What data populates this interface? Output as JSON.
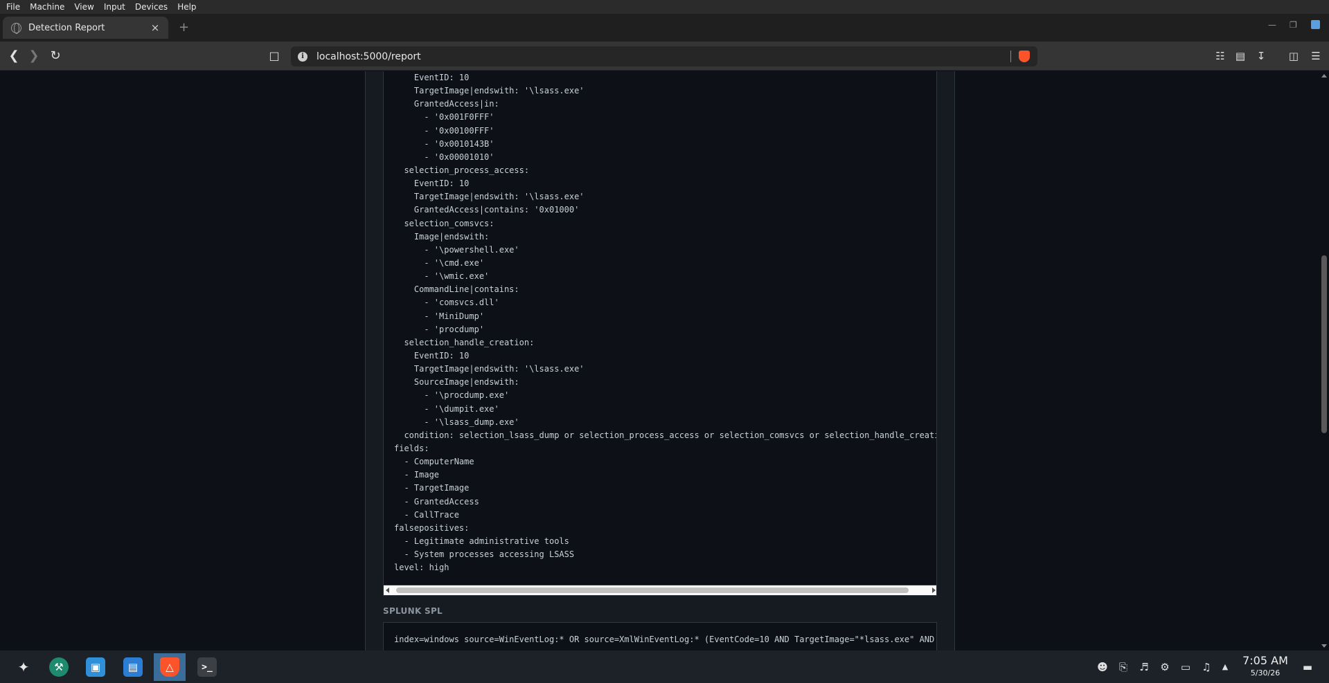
{
  "vm_menu": [
    "File",
    "Machine",
    "View",
    "Input",
    "Devices",
    "Help"
  ],
  "browser": {
    "tab_title": "Detection Report",
    "url": "localhost:5000/report",
    "new_tab_symbol": "+",
    "close_symbol": "×"
  },
  "sigma_lines": [
    "    EventID: 10",
    "    TargetImage|endswith: '\\lsass.exe'",
    "    GrantedAccess|in:",
    "      - '0x001F0FFF'",
    "      - '0x00100FFF'",
    "      - '0x0010143B'",
    "      - '0x00001010'",
    "  selection_process_access:",
    "    EventID: 10",
    "    TargetImage|endswith: '\\lsass.exe'",
    "    GrantedAccess|contains: '0x01000'",
    "  selection_comsvcs:",
    "    Image|endswith:",
    "      - '\\powershell.exe'",
    "      - '\\cmd.exe'",
    "      - '\\wmic.exe'",
    "    CommandLine|contains:",
    "      - 'comsvcs.dll'",
    "      - 'MiniDump'",
    "      - 'procdump'",
    "  selection_handle_creation:",
    "    EventID: 10",
    "    TargetImage|endswith: '\\lsass.exe'",
    "    SourceImage|endswith:",
    "      - '\\procdump.exe'",
    "      - '\\dumpit.exe'",
    "      - '\\lsass_dump.exe'",
    "  condition: selection_lsass_dump or selection_process_access or selection_comsvcs or selection_handle_creati",
    "fields:",
    "  - ComputerName",
    "  - Image",
    "  - TargetImage",
    "  - GrantedAccess",
    "  - CallTrace",
    "falsepositives:",
    "  - Legitimate administrative tools",
    "  - System processes accessing LSASS",
    "level: high"
  ],
  "splunk": {
    "label": "SPLUNK SPL",
    "query": "index=windows source=WinEventLog:* OR source=XmlWinEventLog:* (EventCode=10 AND TargetImage=\"*lsass.exe\" AND"
  },
  "clock": {
    "time": "7:05 AM",
    "date": "5/30/26"
  }
}
